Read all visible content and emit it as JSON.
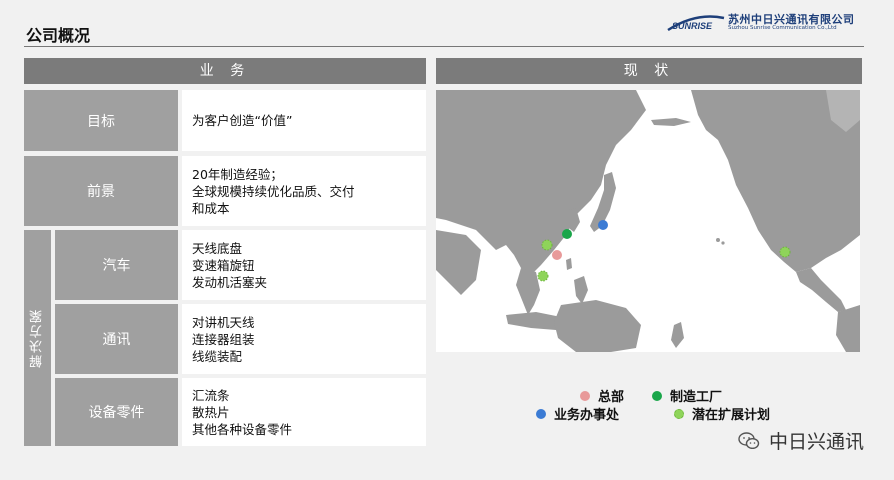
{
  "header": {
    "title": "公司概况",
    "logo_cn": "苏州中日兴通讯有限公司",
    "logo_en": "Suzhou Sunrise Communication Co.,Ltd",
    "logo_mark_text": "SUNRISE"
  },
  "left": {
    "header": "业 务",
    "rows": [
      {
        "label": "目标",
        "lines": [
          "为客户创造“价值”"
        ]
      },
      {
        "label": "前景",
        "lines": [
          "20年制造经验；",
          "全球规模持续优化品质、交付",
          "和成本"
        ]
      }
    ],
    "solutions_label": "解决方案",
    "solutions": [
      {
        "label": "汽车",
        "lines": [
          "天线底盘",
          "变速箱旋钮",
          "发动机活塞夹"
        ]
      },
      {
        "label": "通讯",
        "lines": [
          "对讲机天线",
          "连接器组装",
          "线缆装配"
        ]
      },
      {
        "label": "设备零件",
        "lines": [
          "汇流条",
          "散热片",
          "其他各种设备零件"
        ]
      }
    ]
  },
  "right": {
    "header": "现 状"
  },
  "legend": {
    "hq": "总部",
    "factory": "制造工厂",
    "office": "业务办事处",
    "expansion": "潜在扩展计划"
  },
  "colors": {
    "hq": "#e89a9a",
    "factory": "#1aa64a",
    "office": "#3b7bd4",
    "expansion": "#8fd45a"
  },
  "footer": {
    "wechat_name": "中日兴通讯"
  }
}
